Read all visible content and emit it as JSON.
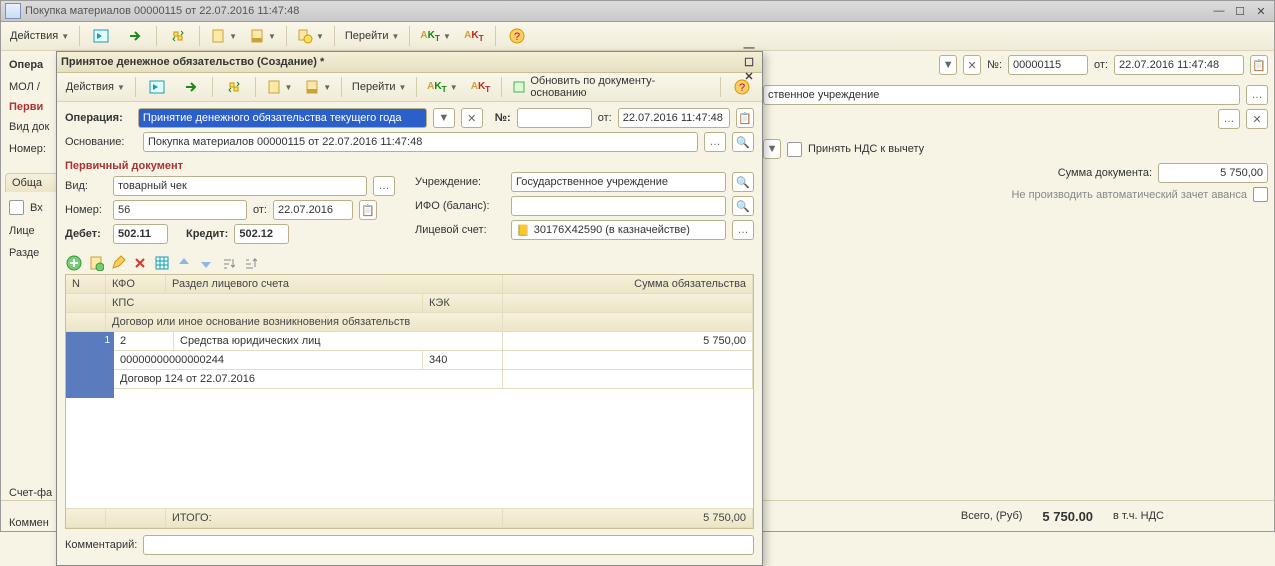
{
  "outer": {
    "title": "Покупка материалов 00000115 от 22.07.2016 11:47:48",
    "toolbar": {
      "actions": "Действия",
      "goto": "Перейти"
    },
    "number_label": "№:",
    "number": "00000115",
    "from_label": "от:",
    "date": "22.07.2016 11:47:48"
  },
  "bg": {
    "opera_prefix": "Опера",
    "mol_prefix": "МОЛ /",
    "pervi": "Перви",
    "vid_dok": "Вид док",
    "nomer": "Номер:",
    "obshcha": "Обща",
    "vkh": "Вх",
    "litse": "Лице",
    "razde": "Разде",
    "schet_fa": "Счет-фа",
    "komment": "Коммен",
    "institution_tail": "ственное учреждение",
    "vat_check": "Принять НДС к вычету",
    "sum_label": "Сумма документа:",
    "sum_value": "5 750,00",
    "no_auto": "Не производить автоматический зачет аванса"
  },
  "modal": {
    "title": "Принятое денежное обязательство (Создание) *",
    "toolbar": {
      "actions": "Действия",
      "goto": "Перейти",
      "refresh": "Обновить по документу-основанию"
    },
    "form": {
      "operation_lbl": "Операция:",
      "operation_val": "Принятие денежного обязательства текущего года",
      "num_lbl": "№:",
      "from_lbl": "от:",
      "date": "22.07.2016 11:47:48",
      "basis_lbl": "Основание:",
      "basis_val": "Покупка материалов 00000115 от 22.07.2016 11:47:48",
      "primary_doc": "Первичный документ",
      "vid_lbl": "Вид:",
      "vid_val": "товарный чек",
      "nomer_lbl": "Номер:",
      "nomer_val": "56",
      "nomer_from": "от:",
      "nomer_date": "22.07.2016",
      "debit_lbl": "Дебет:",
      "debit_val": "502.11",
      "credit_lbl": "Кредит:",
      "credit_val": "502.12",
      "inst_lbl": "Учреждение:",
      "inst_val": "Государственное учреждение",
      "ifo_lbl": "ИФО (баланс):",
      "acct_lbl": "Лицевой счет:",
      "acct_val": "30176X42590 (в казначействе)"
    },
    "table": {
      "headers": {
        "n": "N",
        "kfo": "КФО",
        "section": "Раздел лицевого счета",
        "kps": "КПС",
        "kek": "КЭК",
        "sum": "Сумма обязательства",
        "contract": "Договор или иное основание возникновения обязательств"
      },
      "row": {
        "n": "1",
        "kfo": "2",
        "section": "Средства юридических лиц",
        "kps": "00000000000000244",
        "kek": "340",
        "sum": "5 750,00",
        "contract": "Договор 124 от 22.07.2016"
      },
      "total_lbl": "ИТОГО:",
      "total_val": "5 750,00"
    },
    "comment_lbl": "Комментарий:"
  },
  "footer": {
    "total_lbl": "Всего, (Руб)",
    "total_val": "5 750.00",
    "vat_lbl": "в т.ч. НДС"
  }
}
